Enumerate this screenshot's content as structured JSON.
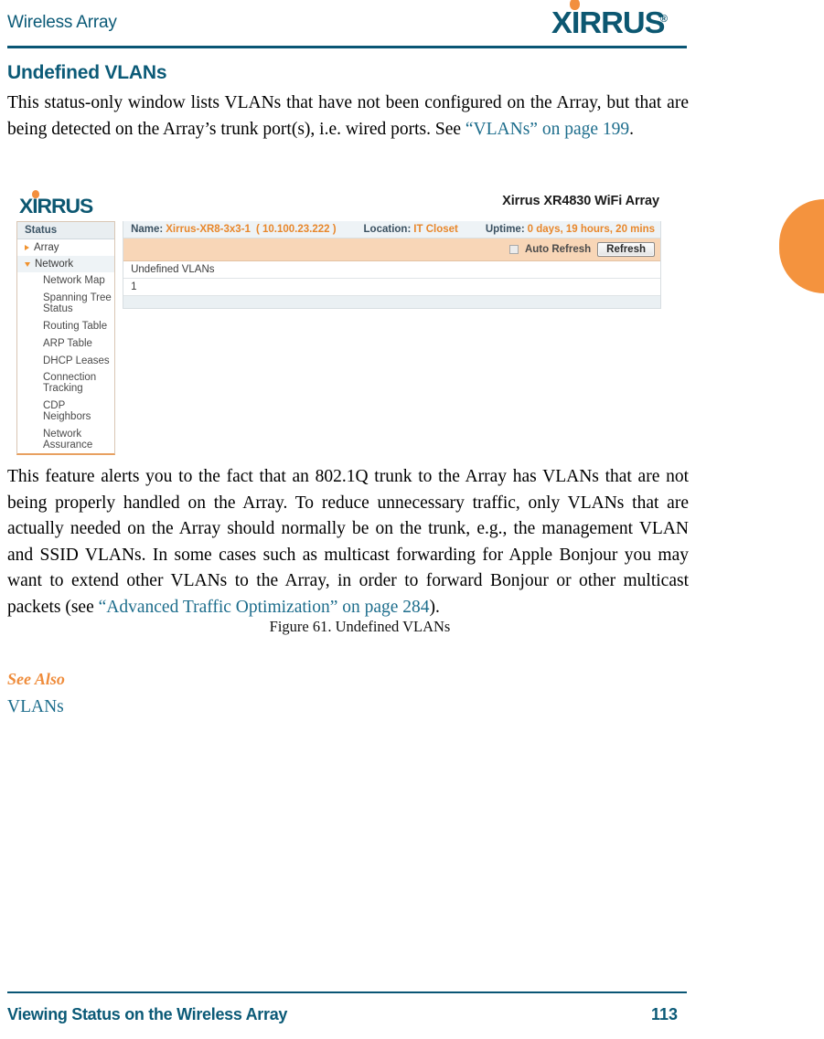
{
  "header": {
    "running_title": "Wireless Array",
    "logo_text": "XIRRUS",
    "logo_reg": "®"
  },
  "section": {
    "heading": "Undefined VLANs",
    "intro_paragraph_part1": "This status-only window lists VLANs that have not been configured on the Array, but that are being detected on the Array’s trunk port(s), i.e. wired ports. See ",
    "intro_link": "“VLANs” on page 199",
    "intro_paragraph_part2": ".",
    "feature_paragraph_part1": "This feature alerts you to the fact that an 802.1Q trunk to the Array has VLANs that are not being properly handled on the Array. To reduce unnecessary traffic, only VLANs that are actually needed on the Array should normally be on the trunk, e.g., the management VLAN and SSID VLANs.  In some cases such as multicast forwarding for Apple Bonjour you may want to extend other VLANs to the Array, in order to forward Bonjour or other multicast packets (see ",
    "feature_link": "“Advanced Traffic Optimization” on page 284",
    "feature_paragraph_part2": ").",
    "see_also_label": "See Also",
    "see_also_link": "VLANs"
  },
  "figure": {
    "caption": "Figure 61. Undefined VLANs",
    "logo_text": "XIRRUS",
    "device_title": "Xirrus XR4830 WiFi Array",
    "infobar": {
      "name_label": "Name:",
      "name_value": "Xirrus-XR8-3x3-1",
      "ip_value": "( 10.100.23.222 )",
      "location_label": "Location:",
      "location_value": "IT Closet",
      "uptime_label": "Uptime:",
      "uptime_value": "0 days, 19 hours, 20 mins"
    },
    "actionbar": {
      "auto_refresh_label": "Auto Refresh",
      "auto_refresh_checked": false,
      "refresh_button": "Refresh"
    },
    "sidebar": {
      "title": "Status",
      "groups": [
        {
          "label": "Array",
          "expanded": false
        },
        {
          "label": "Network",
          "expanded": true
        }
      ],
      "items": [
        {
          "label": "Network Map"
        },
        {
          "label": "Spanning Tree Status"
        },
        {
          "label": "Routing Table"
        },
        {
          "label": "ARP Table"
        },
        {
          "label": "DHCP Leases"
        },
        {
          "label": "Connection Tracking"
        },
        {
          "label": "CDP Neighbors"
        },
        {
          "label": "Network Assurance"
        }
      ]
    },
    "table": {
      "columns": [
        "Undefined VLANs"
      ],
      "rows": [
        [
          "1"
        ]
      ]
    }
  },
  "footer": {
    "left": "Viewing Status on the Wireless Array",
    "page_number": "113"
  },
  "colors": {
    "brand_teal": "#0b5a77",
    "brand_orange": "#f0922e",
    "link_teal": "#1d6d8c",
    "actionbar_peach": "#f8d6b7",
    "infobar_blue": "#eef3f6"
  }
}
